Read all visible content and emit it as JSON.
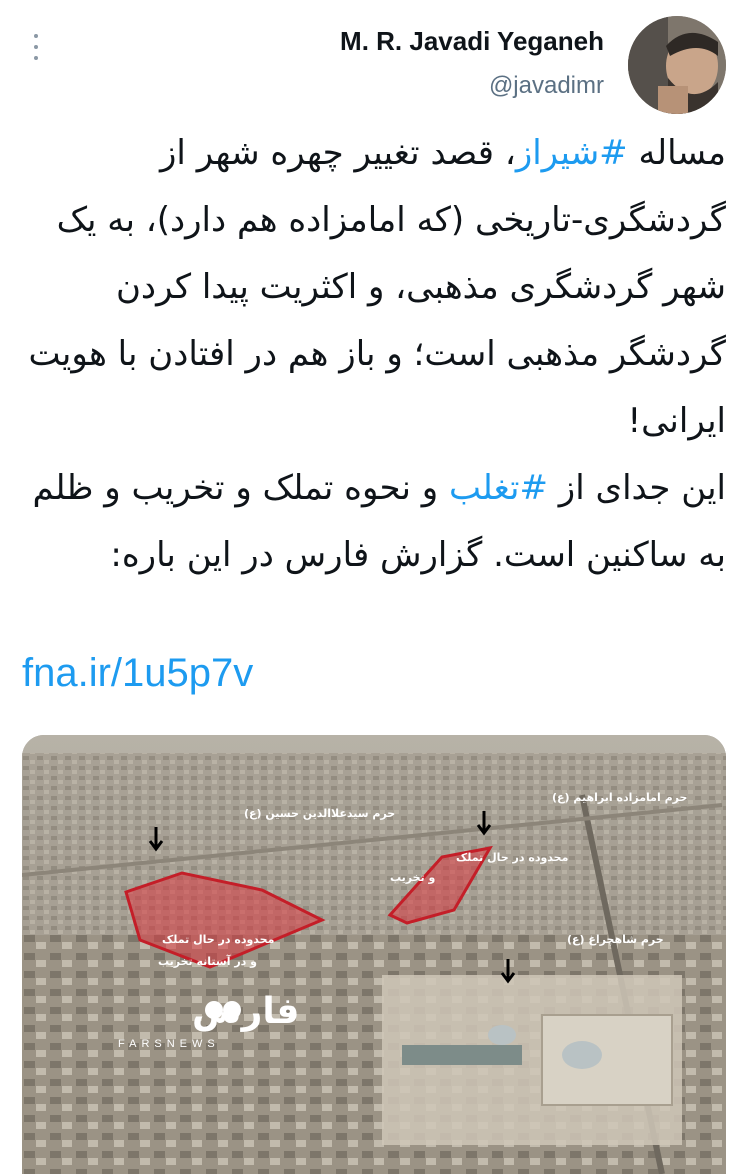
{
  "tweet": {
    "author_name": "M. R. Javadi Yeganeh",
    "author_handle": "@javadimr",
    "paragraph1": {
      "before": "مساله ",
      "hashtag": "#شیراز",
      "after": "، قصد تغییر چهره شهر از گردشگری-تاریخی (که امامزاده هم دارد)، به یک شهر گردشگری مذهبی، و اکثریت پیدا کردن گردشگر مذهبی است؛ و باز هم در افتادن با هویت ایرانی!"
    },
    "paragraph2": {
      "before": "این جدای از ",
      "hashtag": "#تغلب",
      "after": " و نحوه تملک و تخریب و ظلم به ساکنین است. گزارش فارس در این باره:"
    },
    "link": "fna.ir/1u5p7v"
  },
  "media": {
    "labels": {
      "shrine_alaeddin": "حرم سیدعلاالدین حسین (ع)",
      "shrine_ebrahim": "حرم امامزاده ابراهیم (ع)",
      "shrine_shahcheragh": "حرم شاهچراغ (ع)",
      "area_possession_line1": "محدوده در حال تملک",
      "area_possession_line2": "و تخریب",
      "area_demolition_line1": "محدوده در حال تملک",
      "area_demolition_line2": "و در آستانه تخریب"
    },
    "logo_text": "فارس",
    "logo_subtext": "FARSNEWS"
  },
  "colors": {
    "accent": "#1d9bf0",
    "highlight_area_fill": "#d9383f",
    "highlight_area_stroke": "#c41e28"
  },
  "icons": {
    "more": "more-vertical-icon",
    "avatar": "avatar",
    "arrows": "arrow-down-icon"
  }
}
